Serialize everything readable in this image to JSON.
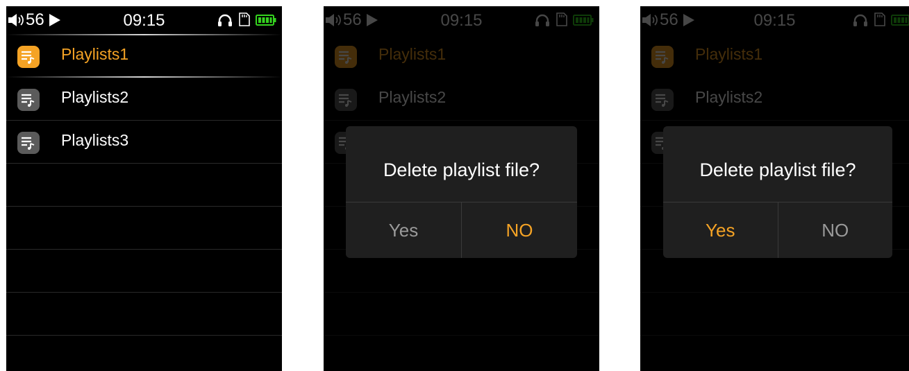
{
  "colors": {
    "accent": "#f5a325",
    "battery": "#35d31f"
  },
  "status": {
    "volume": "56",
    "time": "09:15"
  },
  "playlists": [
    {
      "label": "Playlists1"
    },
    {
      "label": "Playlists2"
    },
    {
      "label": "Playlists3"
    }
  ],
  "dialog": {
    "message": "Delete playlist file?",
    "yes": "Yes",
    "no": "NO"
  },
  "screens": [
    {
      "id": "list",
      "dialog_visible": false
    },
    {
      "id": "dialog-no-focused",
      "dialog_visible": true,
      "focused_button": "no"
    },
    {
      "id": "dialog-yes-focused",
      "dialog_visible": true,
      "focused_button": "yes"
    }
  ],
  "icons": [
    "speaker-icon",
    "play-icon",
    "headphones-icon",
    "sd-card-icon",
    "battery-icon",
    "playlist-icon"
  ]
}
